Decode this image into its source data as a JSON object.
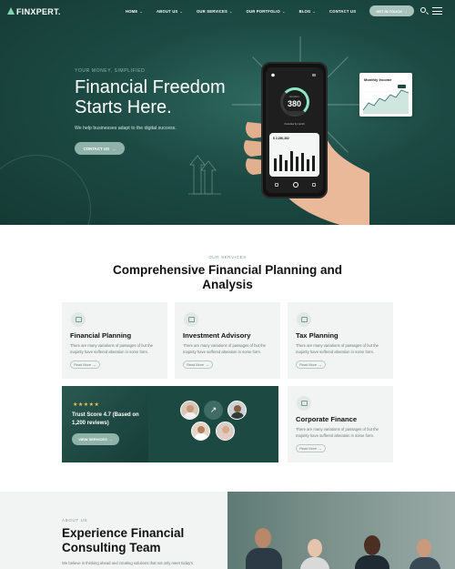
{
  "brand": {
    "name": "FINXPERT."
  },
  "nav": {
    "items": [
      {
        "label": "HOME"
      },
      {
        "label": "ABOUT US"
      },
      {
        "label": "OUR SERVICES"
      },
      {
        "label": "OUR PORTFOLIO"
      },
      {
        "label": "BLOG"
      },
      {
        "label": "CONTACT US"
      }
    ],
    "cta_label": "GET IN TOUCH"
  },
  "hero": {
    "eyebrow": "YOUR MONEY, SIMPLIFIED",
    "title": "Financial Freedom Starts Here.",
    "subtitle": "We help businesses adapt to the digital success.",
    "cta_label": "CONTACT US"
  },
  "phone": {
    "score_label": "Excellent",
    "score": "380",
    "caption": "Overview by month",
    "amount": "$ 2,280,382"
  },
  "monthly_widget": {
    "title": "Monthly Income"
  },
  "services": {
    "eyebrow": "OUR SERVICES",
    "title": "Comprehensive Financial Planning and Analysis",
    "cards": [
      {
        "title": "Financial Planning",
        "desc": "There are many variations of passages of but the majority have suffered alteration in some form.",
        "more": "Read More"
      },
      {
        "title": "Investment Advisory",
        "desc": "There are many variations of passages of but the majority have suffered alteration in some form.",
        "more": "Read More"
      },
      {
        "title": "Tax Planning",
        "desc": "There are many variations of passages of but the majority have suffered alteration in some form.",
        "more": "Read More"
      },
      {
        "title": "Corporate Finance",
        "desc": "There are many variations of passages of but the majority have suffered alteration in some form.",
        "more": "Read More"
      }
    ],
    "trust": {
      "stars": "★★★★★",
      "text": "Trust Score 4.7 (Based on 1,200 reviews)",
      "cta_label": "VIEW SERVICES"
    }
  },
  "about": {
    "eyebrow": "ABOUT US",
    "title": "Experience Financial Consulting Team",
    "text": "We believe in thinking ahead and creating solutions that not only meet today's"
  },
  "colors": {
    "primary": "#1c4a43",
    "accent": "#8fb3a8",
    "light_bg": "#f1f4f3",
    "star": "#f2c14e"
  },
  "icons": [
    "search-icon",
    "menu-icon",
    "arrow-right-icon",
    "chevron-down-icon",
    "calendar-icon",
    "chart-icon",
    "receipt-icon",
    "building-icon"
  ]
}
